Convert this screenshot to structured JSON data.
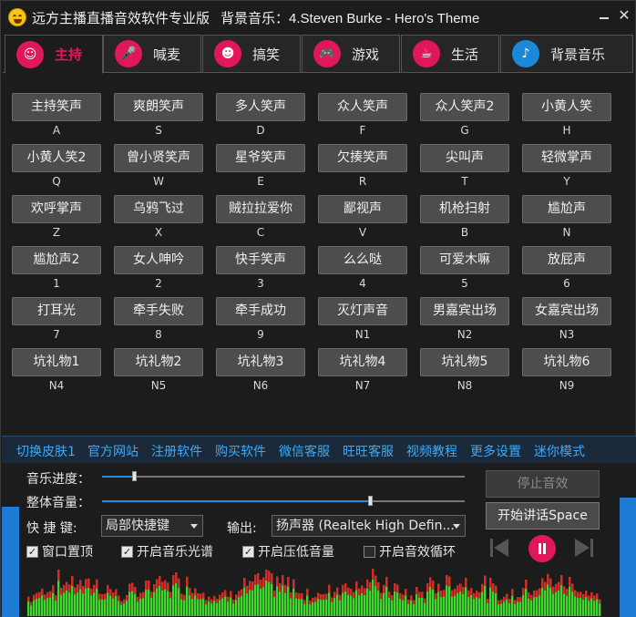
{
  "window": {
    "title": "远方主播直播音效软件专业版",
    "bgm_prefix": "背景音乐：",
    "bgm_track": "4.Steven Burke - Hero's Theme",
    "close_glyph": "✕"
  },
  "tabs": [
    {
      "label": "主持",
      "icon": "host-person-icon",
      "color": "#e0185a",
      "active": true
    },
    {
      "label": "喊麦",
      "icon": "microphone-icon",
      "color": "#e0185a",
      "active": false
    },
    {
      "label": "搞笑",
      "icon": "laughing-face-icon",
      "color": "#e0185a",
      "active": false
    },
    {
      "label": "游戏",
      "icon": "gamepad-icon",
      "color": "#e0185a",
      "active": false
    },
    {
      "label": "生活",
      "icon": "coffee-cup-icon",
      "color": "#e0185a",
      "active": false
    },
    {
      "label": "背景音乐",
      "icon": "music-note-icon",
      "color": "#1e88d8",
      "active": false
    }
  ],
  "sounds": [
    {
      "label": "主持笑声",
      "key": "A"
    },
    {
      "label": "爽朗笑声",
      "key": "S"
    },
    {
      "label": "多人笑声",
      "key": "D"
    },
    {
      "label": "众人笑声",
      "key": "F"
    },
    {
      "label": "众人笑声2",
      "key": "G"
    },
    {
      "label": "小黄人笑",
      "key": "H"
    },
    {
      "label": "小黄人笑2",
      "key": "Q"
    },
    {
      "label": "曾小贤笑声",
      "key": "W"
    },
    {
      "label": "星爷笑声",
      "key": "E"
    },
    {
      "label": "欠揍笑声",
      "key": "R"
    },
    {
      "label": "尖叫声",
      "key": "T"
    },
    {
      "label": "轻微掌声",
      "key": "Y"
    },
    {
      "label": "欢呼掌声",
      "key": "Z"
    },
    {
      "label": "乌鸦飞过",
      "key": "X"
    },
    {
      "label": "贼拉拉爱你",
      "key": "C"
    },
    {
      "label": "鄙视声",
      "key": "V"
    },
    {
      "label": "机枪扫射",
      "key": "B"
    },
    {
      "label": "尴尬声",
      "key": "N"
    },
    {
      "label": "尴尬声2",
      "key": "1"
    },
    {
      "label": "女人呻吟",
      "key": "2"
    },
    {
      "label": "快手笑声",
      "key": "3"
    },
    {
      "label": "么么哒",
      "key": "4"
    },
    {
      "label": "可爱木嘛",
      "key": "5"
    },
    {
      "label": "放屁声",
      "key": "6"
    },
    {
      "label": "打耳光",
      "key": "7"
    },
    {
      "label": "牵手失败",
      "key": "8"
    },
    {
      "label": "牵手成功",
      "key": "9"
    },
    {
      "label": "灭灯声音",
      "key": "N1"
    },
    {
      "label": "男嘉宾出场",
      "key": "N2"
    },
    {
      "label": "女嘉宾出场",
      "key": "N3"
    },
    {
      "label": "坑礼物1",
      "key": "N4"
    },
    {
      "label": "坑礼物2",
      "key": "N5"
    },
    {
      "label": "坑礼物3",
      "key": "N6"
    },
    {
      "label": "坑礼物4",
      "key": "N7"
    },
    {
      "label": "坑礼物5",
      "key": "N8"
    },
    {
      "label": "坑礼物6",
      "key": "N9"
    }
  ],
  "links": [
    "切换皮肤1",
    "官方网站",
    "注册软件",
    "购买软件",
    "微信客服",
    "旺旺客服",
    "视频教程",
    "更多设置",
    "迷你模式"
  ],
  "controls": {
    "progress_label": "音乐进度：",
    "progress_value": 0.09,
    "volume_label": "整体音量：",
    "volume_value": 0.74,
    "hotkey_label": "快 捷 键:",
    "hotkey_value": "局部快捷键",
    "output_label": "输出:",
    "output_value": "扬声器 (Realtek High Defin...",
    "stop_label": "停止音效",
    "talk_label": "开始讲话Space",
    "checkboxes": [
      {
        "label": "窗口置顶",
        "checked": true
      },
      {
        "label": "开启音乐光谱",
        "checked": true
      },
      {
        "label": "开启压低音量",
        "checked": true
      },
      {
        "label": "开启音效循环",
        "checked": false
      }
    ]
  },
  "colors": {
    "accent": "#e0185a",
    "link": "#3fa9f5",
    "side_bar": "#1e7bd4",
    "spectrum_green": "#3ed62a",
    "spectrum_red": "#d62a2a"
  }
}
